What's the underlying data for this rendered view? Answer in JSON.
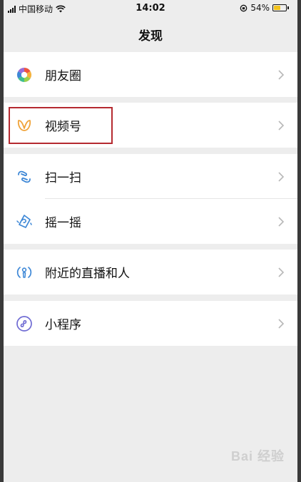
{
  "status_bar": {
    "carrier": "中国移动",
    "time": "14:02",
    "battery": "54%",
    "battery_level": 0.54,
    "battery_color": "#f2c21b"
  },
  "nav": {
    "title": "发现"
  },
  "menu": {
    "moments": "朋友圈",
    "channels": "视频号",
    "scan": "扫一扫",
    "shake": "摇一摇",
    "nearby_live": "附近的直播和人",
    "mini_programs": "小程序"
  },
  "colors": {
    "channels_accent": "#f0a33a",
    "scan_accent": "#3d87d6",
    "nearby_accent": "#3d87d6",
    "mini_accent": "#6f6bd3",
    "highlight_border": "#b52a30"
  },
  "icons": {
    "moments": "moments-aperture-icon",
    "channels": "channels-butterfly-icon",
    "scan": "scan-icon",
    "shake": "shake-icon",
    "nearby_live": "nearby-live-icon",
    "mini_programs": "mini-program-icon",
    "chevron": "chevron-right-icon"
  },
  "watermark": {
    "text": "Bai 经验"
  }
}
